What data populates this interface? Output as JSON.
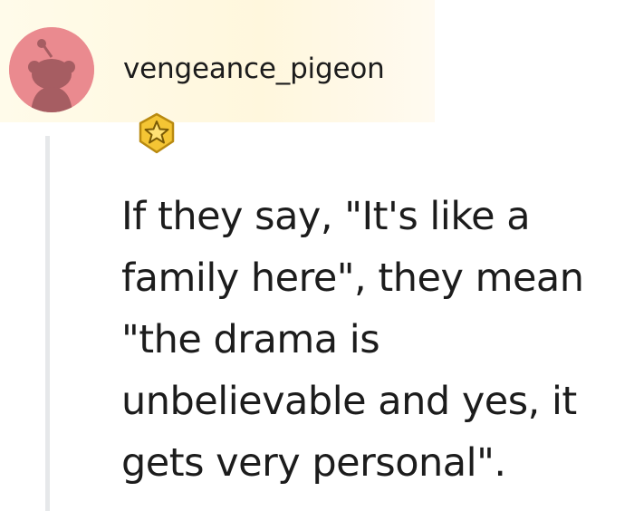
{
  "comment": {
    "username": "vengeance_pigeon",
    "avatar_icon": "snoo-avatar-icon",
    "avatar_color": "#ea8a8f",
    "badge_icon": "star-award-icon",
    "body": "If they say, \"It's like a family here\", they mean \"the drama is unbelievable and yes, it gets very personal\"."
  },
  "colors": {
    "highlight": "#fff7dd",
    "thread_line": "#e6e8ea",
    "text": "#1c1c1c",
    "badge_gold": "#f4c534"
  }
}
